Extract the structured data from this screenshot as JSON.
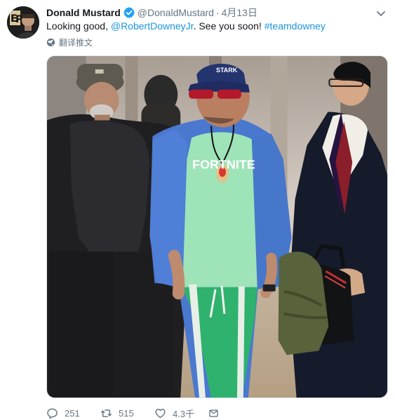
{
  "tweet": {
    "author": {
      "name": "Donald Mustard",
      "handle": "@DonaldMustard",
      "verified_icon": "verified-badge-icon",
      "avatar_icon": "profile-avatar"
    },
    "separator": "·",
    "date": "4月13日",
    "text": {
      "before": "Looking good, ",
      "mention": "@RobertDowneyJr",
      "middle": ". See you soon! ",
      "hashtag": "#teamdowney"
    },
    "translate_label": "翻译推文",
    "media": {
      "logo_text": "FORTNITE",
      "cap_text": "STARK"
    },
    "actions": {
      "reply_count": "251",
      "retweet_count": "515",
      "like_count": "4.3千"
    },
    "colors": {
      "link": "#1b95e0",
      "muted": "#657786",
      "text": "#14171a",
      "verified": "#1da1f2"
    }
  }
}
